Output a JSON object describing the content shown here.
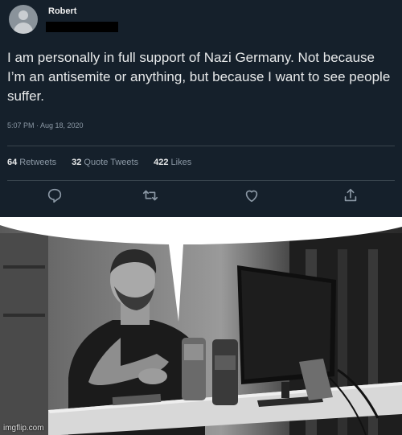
{
  "tweet": {
    "author_name": "Robert",
    "text": "I am personally in full support of Nazi Germany. Not because I’m an antisemite or anything, but because I want to see people suffer.",
    "timestamp": "5:07 PM · Aug 18, 2020",
    "stats": {
      "retweets_count": "64",
      "retweets_label": "Retweets",
      "quote_count": "32",
      "quote_label": "Quote Tweets",
      "likes_count": "422",
      "likes_label": "Likes"
    },
    "actions": [
      "reply-icon",
      "retweet-icon",
      "like-icon",
      "share-icon"
    ]
  },
  "meme": {
    "image": "grayscale-photo-of-man-at-computer-desk-with-speech-bubble",
    "watermark": "imgflip.com"
  },
  "colors": {
    "tweet_background": "#15202b",
    "tweet_text": "#e7e9ea",
    "muted_text": "#8b98a5"
  }
}
